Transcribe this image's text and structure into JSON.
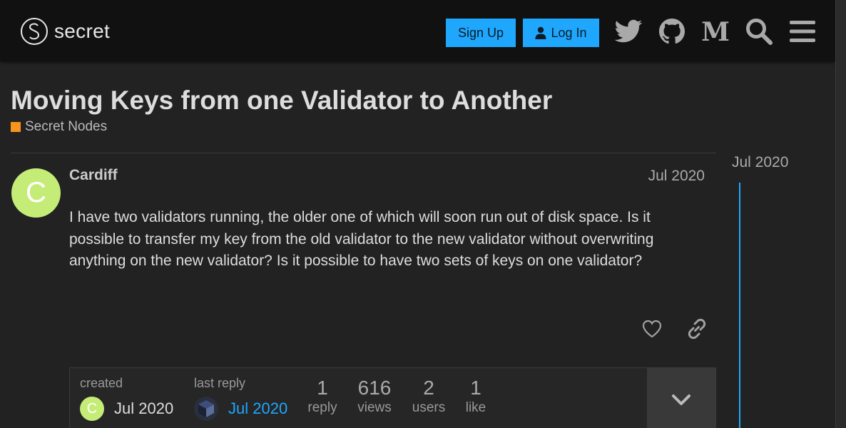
{
  "header": {
    "logo_text": "secret",
    "signup_label": "Sign Up",
    "login_label": "Log In",
    "icons": [
      "twitter-icon",
      "github-icon",
      "medium-icon",
      "search-icon",
      "hamburger-menu-icon"
    ]
  },
  "topic": {
    "title": "Moving Keys from one Validator to Another",
    "category": "Secret Nodes",
    "category_color": "#f7941d"
  },
  "post": {
    "avatar_letter": "C",
    "avatar_color": "#c6ec78",
    "username": "Cardiff",
    "date": "Jul 2020",
    "body": "I have two validators running, the older one of which will soon run out of disk space. Is it possible to transfer my key from the old validator to the new validator without overwriting anything on the new validator? Is it possible to have two sets of keys on one validator?"
  },
  "topic_map": {
    "created_label": "created",
    "created_date": "Jul 2020",
    "created_avatar_letter": "C",
    "last_reply_label": "last reply",
    "last_reply_date": "Jul 2020",
    "stats": [
      {
        "num": "1",
        "label": "reply"
      },
      {
        "num": "616",
        "label": "views"
      },
      {
        "num": "2",
        "label": "users"
      },
      {
        "num": "1",
        "label": "like"
      }
    ]
  },
  "timeline": {
    "date": "Jul 2020"
  },
  "colors": {
    "accent": "#1ea7fd",
    "background": "#222222",
    "header": "#111111"
  }
}
